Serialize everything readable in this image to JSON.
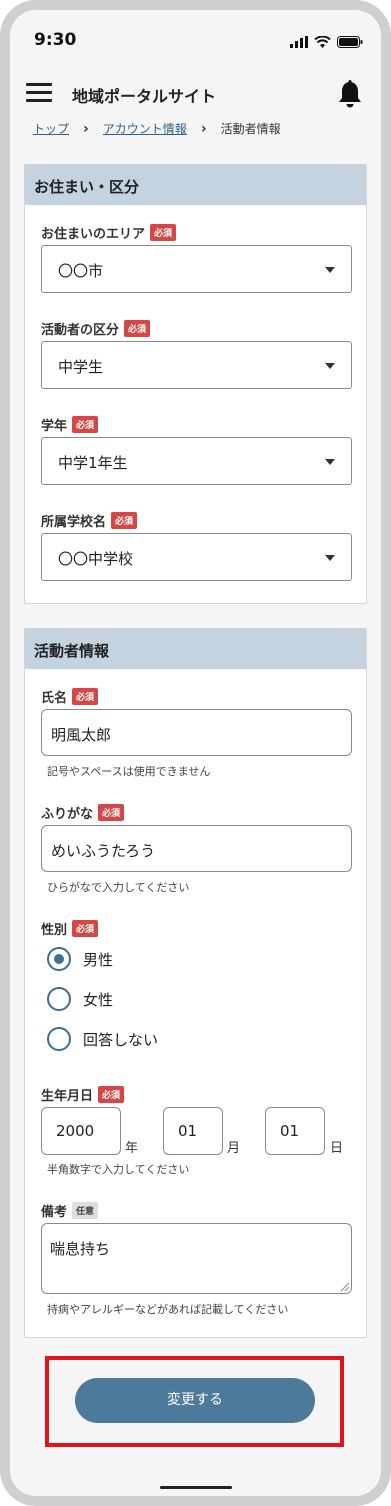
{
  "status": {
    "time": "9:30"
  },
  "header": {
    "title": "地域ポータルサイト"
  },
  "breadcrumb": {
    "items": [
      "トップ",
      "アカウント情報",
      "活動者情報"
    ]
  },
  "residence": {
    "title": "お住まい・区分",
    "required_badge": "必須",
    "fields": [
      {
        "label": "お住まいのエリア",
        "value": "〇〇市"
      },
      {
        "label": "活動者の区分",
        "value": "中学生"
      },
      {
        "label": "学年",
        "value": "中学1年生"
      },
      {
        "label": "所属学校名",
        "value": "〇〇中学校"
      }
    ]
  },
  "activist": {
    "title": "活動者情報",
    "required_badge": "必須",
    "optional_badge": "任意",
    "name": {
      "label": "氏名",
      "value": "明風太郎",
      "hint": "記号やスペースは使用できません"
    },
    "furigana": {
      "label": "ふりがな",
      "value": "めいふうたろう",
      "hint": "ひらがなで入力してください"
    },
    "gender": {
      "label": "性別",
      "options": [
        "男性",
        "女性",
        "回答しない"
      ],
      "selected": "男性"
    },
    "birthdate": {
      "label": "生年月日",
      "year": "2000",
      "year_unit": "年",
      "month": "01",
      "month_unit": "月",
      "day": "01",
      "day_unit": "日",
      "hint": "半角数字で入力してください"
    },
    "notes": {
      "label": "備考",
      "value": "喘息持ち",
      "hint": "持病やアレルギーなどがあれば記載してください"
    }
  },
  "submit": {
    "label": "変更する"
  },
  "colors": {
    "accent": "#4d7a9b",
    "required": "#d54747",
    "section_header": "#c3d4e0",
    "highlight_border": "#e0141e"
  }
}
